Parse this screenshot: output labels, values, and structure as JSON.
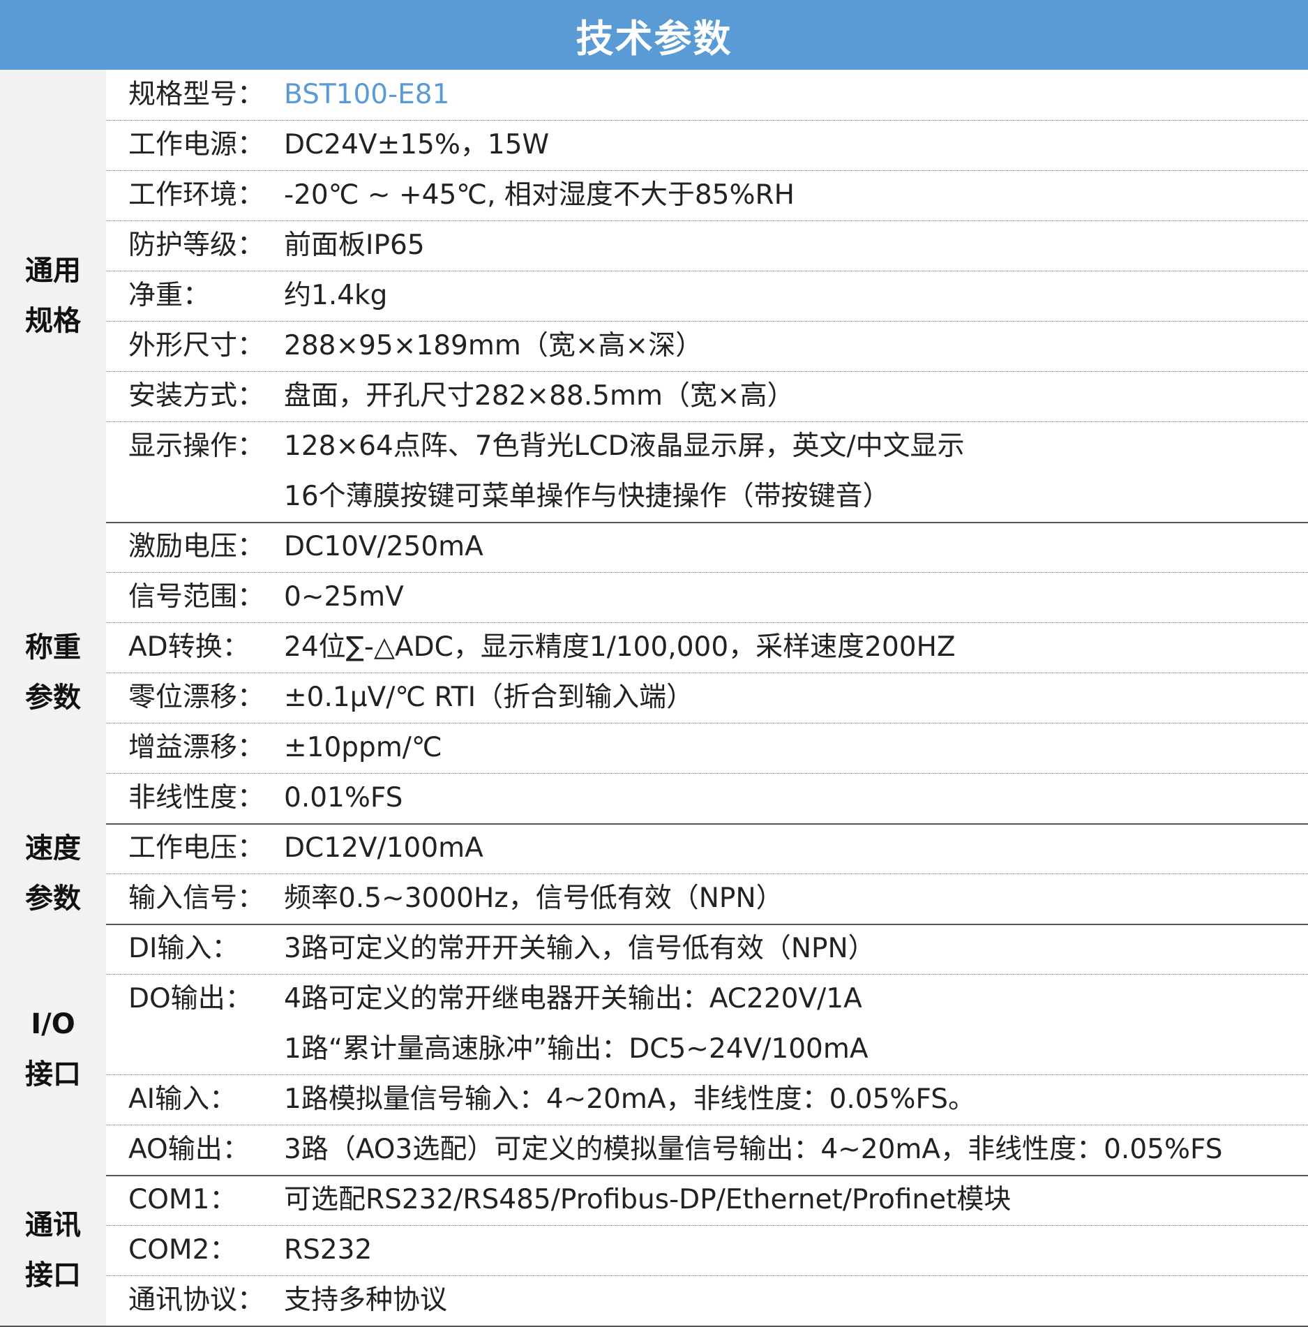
{
  "title": "技术参数",
  "sections": [
    {
      "label": [
        "通用",
        "规格"
      ],
      "rows": [
        {
          "key": "规格型号：",
          "val": [
            "BST100-E81"
          ]
        },
        {
          "key": "工作电源：",
          "val": [
            "DC24V±15%，15W"
          ]
        },
        {
          "key": "工作环境：",
          "val": [
            "-20℃ ~ +45℃, 相对湿度不大于85%RH"
          ]
        },
        {
          "key": "防护等级：",
          "val": [
            "前面板IP65"
          ]
        },
        {
          "key": "净重：",
          "val": [
            "约1.4kg"
          ]
        },
        {
          "key": "外形尺寸：",
          "val": [
            "288×95×189mm（宽×高×深）"
          ]
        },
        {
          "key": "安装方式：",
          "val": [
            "盘面，开孔尺寸282×88.5mm（宽×高）"
          ]
        },
        {
          "key": "显示操作：",
          "val": [
            "128×64点阵、7色背光LCD液晶显示屏，英文/中文显示",
            "16个薄膜按键可菜单操作与快捷操作（带按键音）"
          ]
        }
      ]
    },
    {
      "label": [
        "称重",
        "参数"
      ],
      "rows": [
        {
          "key": "激励电压：",
          "val": [
            "DC10V/250mA"
          ]
        },
        {
          "key": "信号范围：",
          "val": [
            "0~25mV"
          ]
        },
        {
          "key": "AD转换：",
          "val": [
            "24位∑-△ADC，显示精度1/100,000，采样速度200HZ"
          ]
        },
        {
          "key": "零位漂移：",
          "val": [
            "±0.1μV/℃ RTI（折合到输入端）"
          ]
        },
        {
          "key": "增益漂移：",
          "val": [
            "±10ppm/℃"
          ]
        },
        {
          "key": "非线性度：",
          "val": [
            "0.01%FS"
          ]
        }
      ]
    },
    {
      "label": [
        "速度",
        "参数"
      ],
      "rows": [
        {
          "key": "工作电压：",
          "val": [
            "DC12V/100mA"
          ]
        },
        {
          "key": "输入信号：",
          "val": [
            "频率0.5~3000Hz，信号低有效（NPN）"
          ]
        }
      ]
    },
    {
      "label": [
        "I/O",
        "接口"
      ],
      "rows": [
        {
          "key": "DI输入：",
          "val": [
            "3路可定义的常开开关输入，信号低有效（NPN）"
          ]
        },
        {
          "key": "DO输出：",
          "val": [
            "4路可定义的常开继电器开关输出：AC220V/1A",
            "1路“累计量高速脉冲”输出：DC5~24V/100mA"
          ]
        },
        {
          "key": "AI输入：",
          "val": [
            "1路模拟量信号输入：4~20mA，非线性度：0.05%FS。"
          ]
        },
        {
          "key": "AO输出：",
          "val": [
            "3路（AO3选配）可定义的模拟量信号输出：4~20mA，非线性度：0.05%FS"
          ]
        }
      ]
    },
    {
      "label": [
        "通讯",
        "接口"
      ],
      "rows": [
        {
          "key": "COM1：",
          "val": [
            "可选配RS232/RS485/Profibus-DP/Ethernet/Profinet模块"
          ]
        },
        {
          "key": "COM2：",
          "val": [
            "RS232"
          ]
        },
        {
          "key": "通讯协议：",
          "val": [
            "支持多种协议"
          ]
        }
      ]
    }
  ]
}
